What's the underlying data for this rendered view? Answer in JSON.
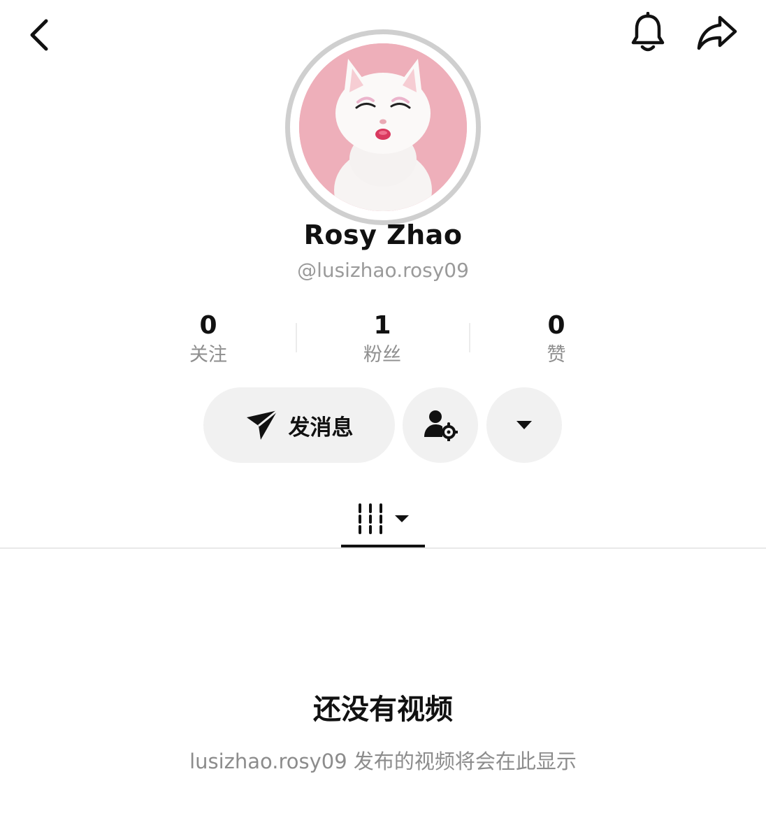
{
  "header": {
    "back_icon": "chevron-left-icon",
    "notification_icon": "bell-icon",
    "share_icon": "share-arrow-icon"
  },
  "profile": {
    "avatar_description": "white fluffy cat with closed eyes and pink lips on pink background",
    "display_name": "Rosy Zhao",
    "handle": "@lusizhao.rosy09"
  },
  "stats": [
    {
      "value": "0",
      "label": "关注"
    },
    {
      "value": "1",
      "label": "粉丝"
    },
    {
      "value": "0",
      "label": "赞"
    }
  ],
  "actions": {
    "message_label": "发消息",
    "message_icon": "send-icon",
    "settings_icon": "user-settings-icon",
    "more_icon": "caret-down-icon"
  },
  "tabs": {
    "videos_icon": "video-grid-icon",
    "dropdown_icon": "caret-down-icon"
  },
  "empty_state": {
    "title": "还没有视频",
    "description": "lusizhao.rosy09 发布的视频将会在此显示"
  },
  "colors": {
    "accent": "#111111",
    "muted_text": "#8e8e8e",
    "button_bg": "#f1f1f1",
    "avatar_ring": "#cfcfcf",
    "avatar_bg": "#eeafba"
  }
}
